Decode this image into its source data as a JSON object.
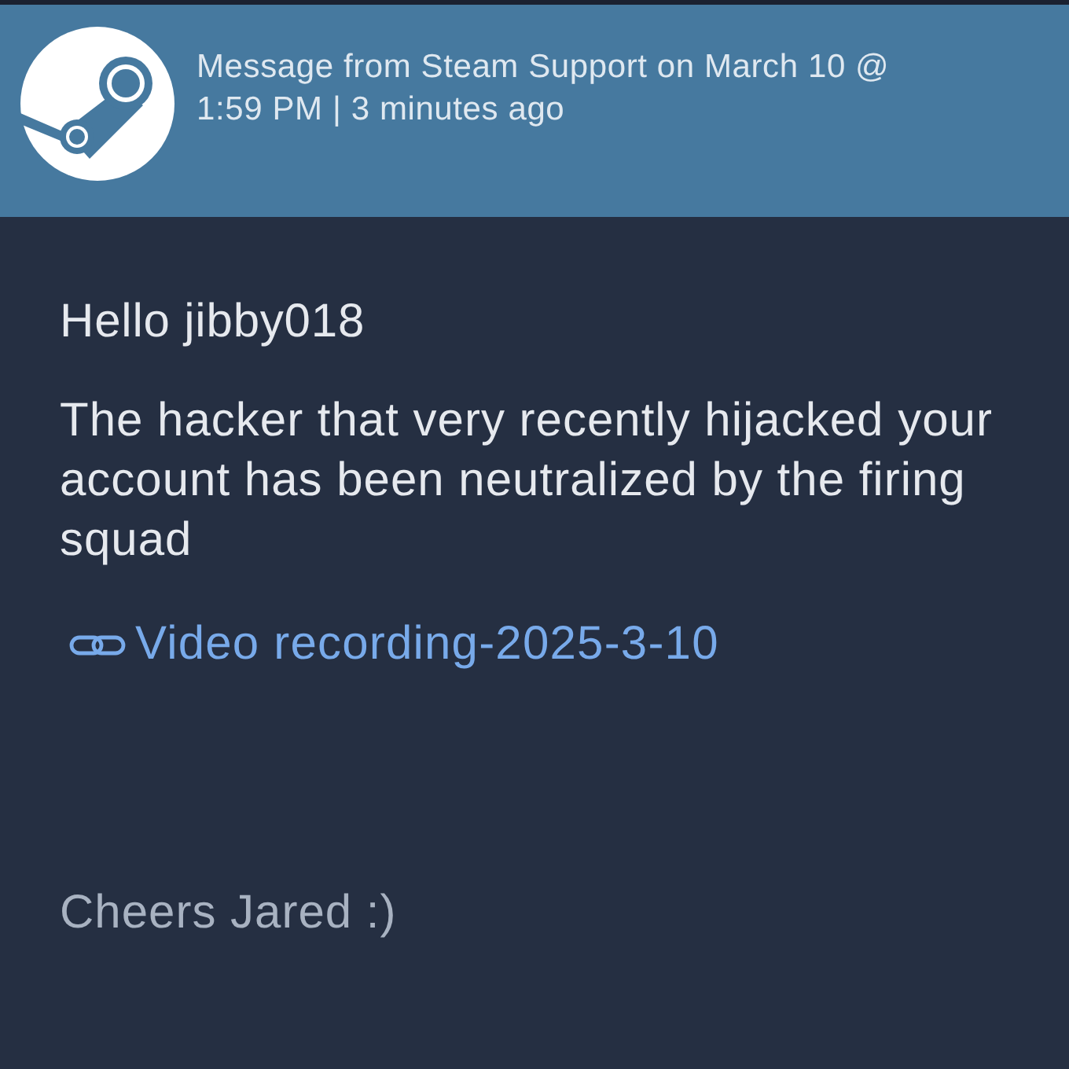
{
  "header": {
    "title": "Message from Steam Support on March 10 @ 1:59 PM | 3 minutes ago"
  },
  "message": {
    "greeting": "Hello jibby018",
    "body": "The hacker that very recently hijacked your account has been neutralized by the firing squad",
    "link": {
      "label": "Video recording-2025-3-10"
    },
    "signoff": "Cheers Jared :)"
  }
}
